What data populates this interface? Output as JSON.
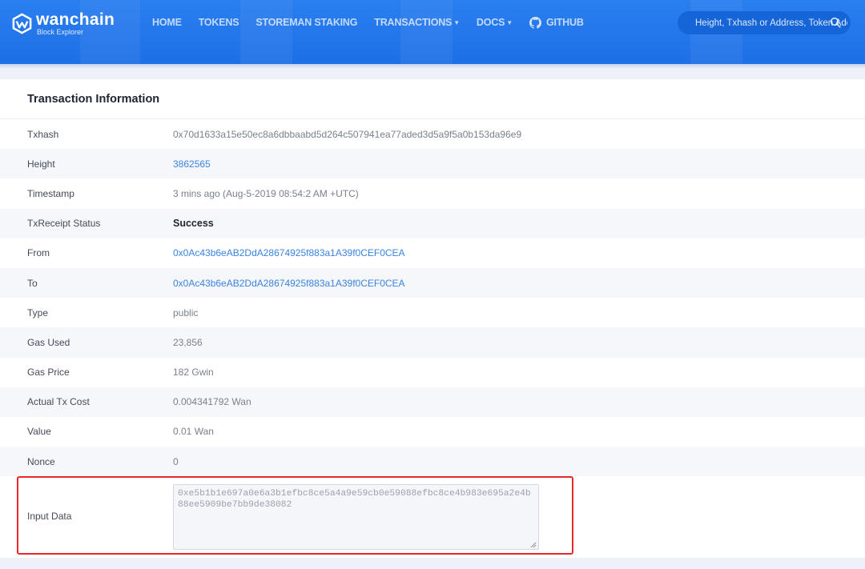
{
  "brand": {
    "name": "wanchain",
    "subtitle": "Block Explorer"
  },
  "nav": {
    "home": "HOME",
    "tokens": "TOKENS",
    "staking": "STOREMAN STAKING",
    "transactions": "TRANSACTIONS",
    "docs": "DOCS",
    "github": "GITHUB"
  },
  "search": {
    "placeholder": "Height, Txhash or Address, Token Address"
  },
  "card": {
    "title": "Transaction Information"
  },
  "details": {
    "txhash": {
      "label": "Txhash",
      "value": "0x70d1633a15e50ec8a6dbbaabd5d264c507941ea77aded3d5a9f5a0b153da96e9"
    },
    "height": {
      "label": "Height",
      "value": "3862565"
    },
    "timestamp": {
      "label": "Timestamp",
      "value": "3 mins ago (Aug-5-2019 08:54:2 AM +UTC)"
    },
    "status": {
      "label": "TxReceipt Status",
      "value": "Success"
    },
    "from": {
      "label": "From",
      "value": "0x0Ac43b6eAB2DdA28674925f883a1A39f0CEF0CEA"
    },
    "to": {
      "label": "To",
      "value": "0x0Ac43b6eAB2DdA28674925f883a1A39f0CEF0CEA"
    },
    "type": {
      "label": "Type",
      "value": "public"
    },
    "gas_used": {
      "label": "Gas Used",
      "value": "23,856"
    },
    "gas_price": {
      "label": "Gas Price",
      "value": "182 Gwin"
    },
    "tx_cost": {
      "label": "Actual Tx Cost",
      "value": "0.004341792 Wan"
    },
    "value": {
      "label": "Value",
      "value": "0.01 Wan"
    },
    "nonce": {
      "label": "Nonce",
      "value": "0"
    },
    "input": {
      "label": "Input Data",
      "value": "0xe5b1b1e697a0e6a3b1efbc8ce5a4a9e59cb0e59088efbc8ce4b983e695a2e4b88ee5909be7bb9de38082"
    }
  },
  "colors": {
    "header": "#1e6fe6",
    "link": "#3b83e0",
    "highlight": "#e8282b"
  },
  "icons": [
    "wanchain-logo-icon",
    "github-icon",
    "search-icon",
    "chevron-down-icon",
    "resize-grip-icon"
  ]
}
